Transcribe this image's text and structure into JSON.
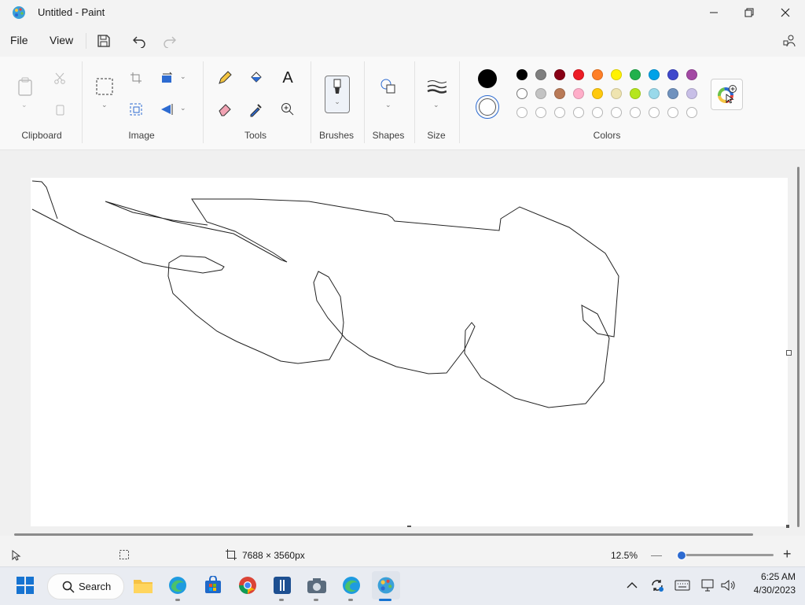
{
  "window": {
    "title": "Untitled - Paint"
  },
  "menu": {
    "file": "File",
    "view": "View"
  },
  "ribbon": {
    "groups": {
      "clipboard": "Clipboard",
      "image": "Image",
      "tools": "Tools",
      "brushes": "Brushes",
      "shapes": "Shapes",
      "size": "Size",
      "colors": "Colors"
    },
    "text_tool": "A"
  },
  "colors": {
    "primary": "#000000",
    "secondary": "#ffffff",
    "row1": [
      "#000000",
      "#7f7f7f",
      "#880015",
      "#ed1c24",
      "#ff7f27",
      "#fff200",
      "#22b14c",
      "#00a2e8",
      "#3f48cc",
      "#a349a4"
    ],
    "row2": [
      "#ffffff",
      "#c3c3c3",
      "#b97a57",
      "#ffaec9",
      "#ffc90e",
      "#efe4b0",
      "#b5e61d",
      "#99d9ea",
      "#7092be",
      "#c8bfe7"
    ]
  },
  "status": {
    "image_size": "7688 × 3560px",
    "zoom": "12.5%",
    "zoom_fraction": 0.03
  },
  "taskbar": {
    "search": "Search",
    "time": "6:25 AM",
    "date": "4/30/2023"
  }
}
